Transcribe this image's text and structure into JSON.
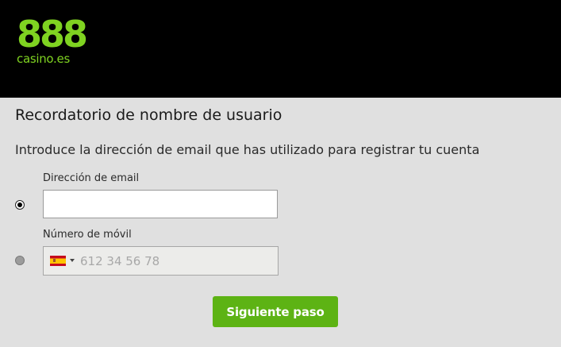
{
  "brand": {
    "digits": "888",
    "domain": "casino.es",
    "accent_color": "#7fd321",
    "header_bg": "#000000"
  },
  "form": {
    "title": "Recordatorio de nombre de usuario",
    "intro": "Introduce la dirección de email que has utilizado para registrar tu cuenta",
    "selected_option": "email",
    "email": {
      "label": "Dirección de email",
      "value": "",
      "selected": true
    },
    "mobile": {
      "label": "Número de móvil",
      "placeholder": "612 34 56 78",
      "country_icon": "spain-flag-icon",
      "selected": false
    },
    "submit_label": "Siguiente paso",
    "submit_color": "#5db314"
  }
}
